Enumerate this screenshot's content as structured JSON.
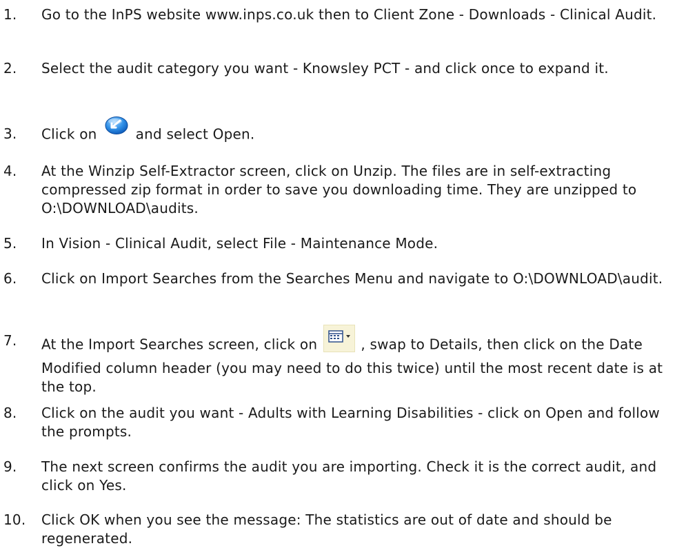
{
  "steps": [
    {
      "number": "1.",
      "text": "Go to the InPS website www.inps.co.uk then to Client Zone - Downloads - Clinical Audit."
    },
    {
      "number": "2.",
      "text": "Select the audit category you want - Knowsley PCT - and click once to expand it."
    },
    {
      "number": "3.",
      "before": "Click on",
      "icon": "download-icon",
      "after": "and select Open."
    },
    {
      "number": "4.",
      "text": "At the Winzip Self-Extractor screen, click on Unzip.  The files are in self-extracting compressed zip format in order to save you downloading time. They are unzipped to O:\\DOWNLOAD\\audits."
    },
    {
      "number": "5.",
      "text": "In Vision - Clinical Audit, select File - Maintenance Mode."
    },
    {
      "number": "6.",
      "text": "Click on Import Searches from the Searches Menu and navigate to O:\\DOWNLOAD\\audit."
    },
    {
      "number": "7.",
      "before": "At the Import Searches screen, click on",
      "icon": "views-menu-icon",
      "after": ", swap to Details, then click on the Date Modified column header (you may need to do this twice) until the most recent date is at the top."
    },
    {
      "number": "8.",
      "text": "Click on the audit you want  -  Adults with Learning Disabilities - click on Open and follow the prompts."
    },
    {
      "number": "9.",
      "text": "The next screen confirms the audit you are importing.  Check it is the correct audit, and click on Yes."
    },
    {
      "number": "10.",
      "text": "Click OK when you see the message: The statistics are out of date and should be regenerated."
    }
  ]
}
